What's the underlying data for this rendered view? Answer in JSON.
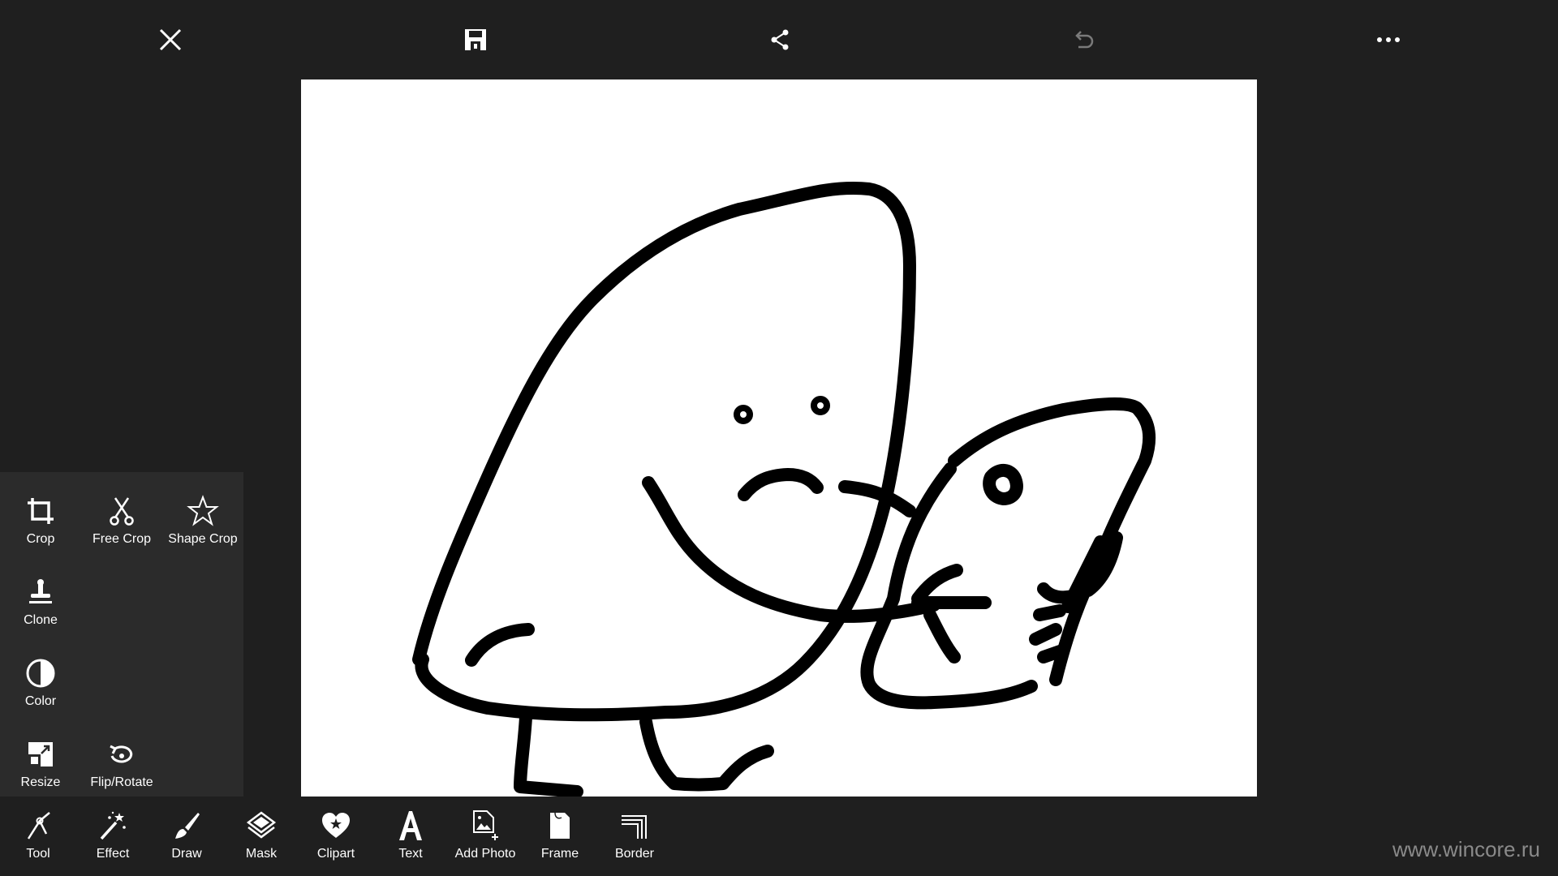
{
  "toolbar": {
    "close": "close-icon",
    "save": "save-icon",
    "share": "share-icon",
    "undo": "undo-icon",
    "more": "more-icon"
  },
  "submenu": {
    "items": [
      {
        "label": "Crop",
        "icon": "crop-icon"
      },
      {
        "label": "Free Crop",
        "icon": "scissors-icon"
      },
      {
        "label": "Shape Crop",
        "icon": "star-icon"
      },
      {
        "label": "Clone",
        "icon": "stamp-icon"
      },
      {
        "label": "Color",
        "icon": "contrast-icon"
      },
      {
        "label": "Resize",
        "icon": "resize-icon"
      },
      {
        "label": "Flip/Rotate",
        "icon": "rotate-icon"
      }
    ]
  },
  "bottom": {
    "items": [
      {
        "label": "Tool",
        "icon": "compass-icon"
      },
      {
        "label": "Effect",
        "icon": "magic-wand-icon"
      },
      {
        "label": "Draw",
        "icon": "brush-icon"
      },
      {
        "label": "Mask",
        "icon": "layers-icon"
      },
      {
        "label": "Clipart",
        "icon": "heart-star-icon"
      },
      {
        "label": "Text",
        "icon": "letter-a-icon"
      },
      {
        "label": "Add Photo",
        "icon": "add-photo-icon"
      },
      {
        "label": "Frame",
        "icon": "frame-icon"
      },
      {
        "label": "Border",
        "icon": "border-icon"
      }
    ]
  },
  "watermark": "www.wincore.ru",
  "colors": {
    "background": "#1f1f1f",
    "panel": "#2b2b2b",
    "canvas": "#ffffff",
    "ink": "#000000"
  }
}
